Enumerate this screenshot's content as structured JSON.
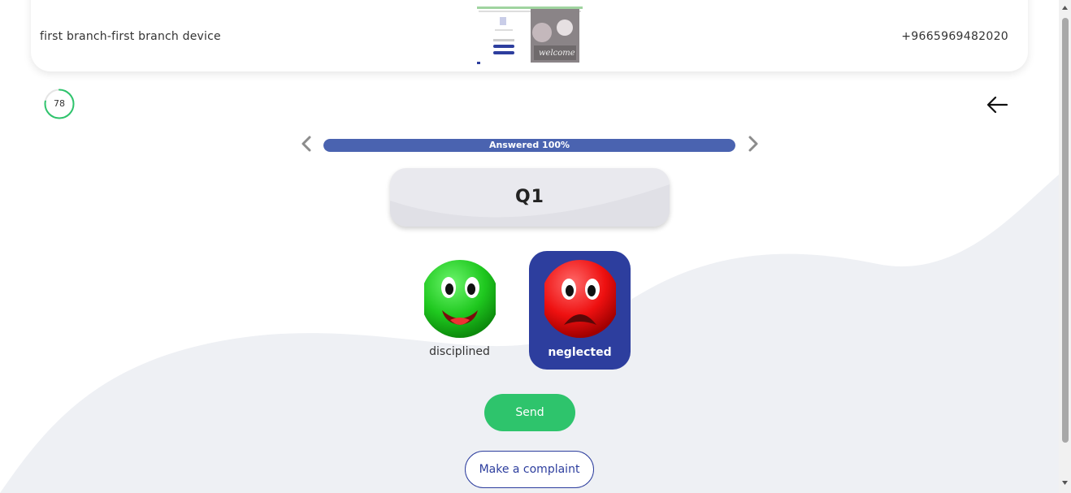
{
  "header": {
    "branch_device": "first branch-first branch device",
    "phone": "+9665969482020",
    "thumbnail_caption": "welcome"
  },
  "score": {
    "value": "78",
    "ring_fraction": 0.78
  },
  "progress": {
    "label": "Answered 100%",
    "fraction": 1.0
  },
  "question": {
    "title": "Q1"
  },
  "options": [
    {
      "label": "disciplined",
      "icon": "happy-green-face-icon",
      "selected": false
    },
    {
      "label": "neglected",
      "icon": "sad-red-face-icon",
      "selected": true
    }
  ],
  "actions": {
    "send": "Send",
    "complaint": "Make a complaint"
  },
  "colors": {
    "primary": "#2d3e9e",
    "progress": "#4a63b0",
    "success": "#2ec46c",
    "score_ring": "#2ec46c"
  }
}
